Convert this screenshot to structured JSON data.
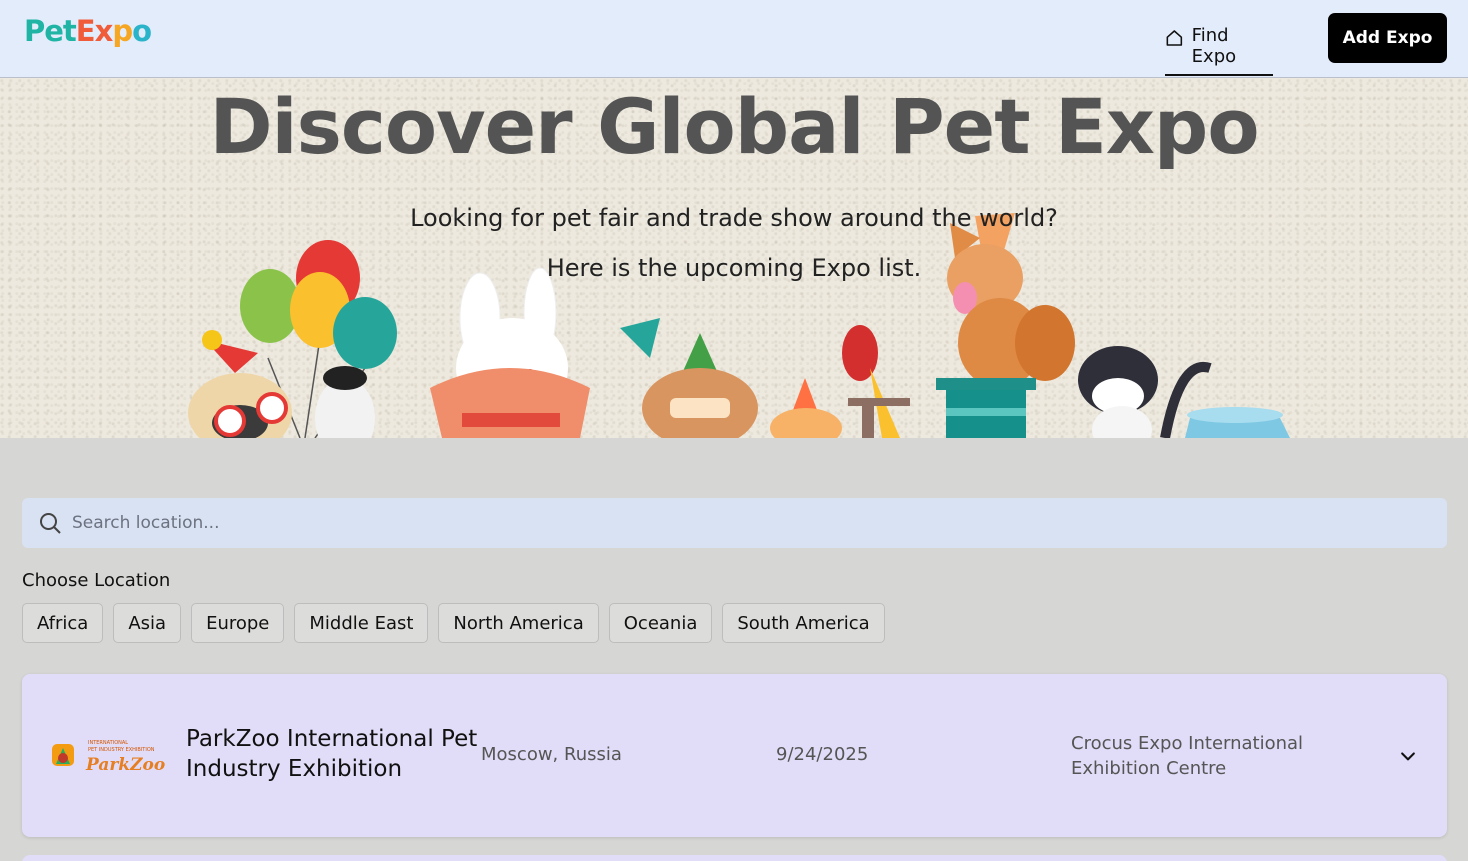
{
  "header": {
    "logo": {
      "part1": "Pet",
      "part2": "Ex",
      "part3": "p",
      "part4": "o"
    },
    "nav_find": "Find Expo",
    "add_button": "Add Expo"
  },
  "hero": {
    "title": "Discover Global Pet Expo",
    "subtitle1": "Looking for pet fair and trade show around the world?",
    "subtitle2": "Here is the upcoming Expo list."
  },
  "search": {
    "placeholder": "Search location..."
  },
  "location_filter": {
    "label": "Choose Location",
    "options": [
      "Africa",
      "Asia",
      "Europe",
      "Middle East",
      "North America",
      "Oceania",
      "South America"
    ]
  },
  "expos": [
    {
      "name": "ParkZoo International Pet Industry Exhibition",
      "location": "Moscow, Russia",
      "date": "9/24/2025",
      "venue": "Crocus Expo International Exhibition Centre",
      "logo": {
        "line1": "INTERNATIONAL",
        "line2": "PET INDUSTRY EXHIBITION",
        "brand": "ParkZoo"
      }
    }
  ],
  "colors": {
    "header_bg": "#e3ecfb",
    "card_bg": "#e1ddf8",
    "search_bg": "#d9e2f2",
    "accent": "#000000"
  }
}
